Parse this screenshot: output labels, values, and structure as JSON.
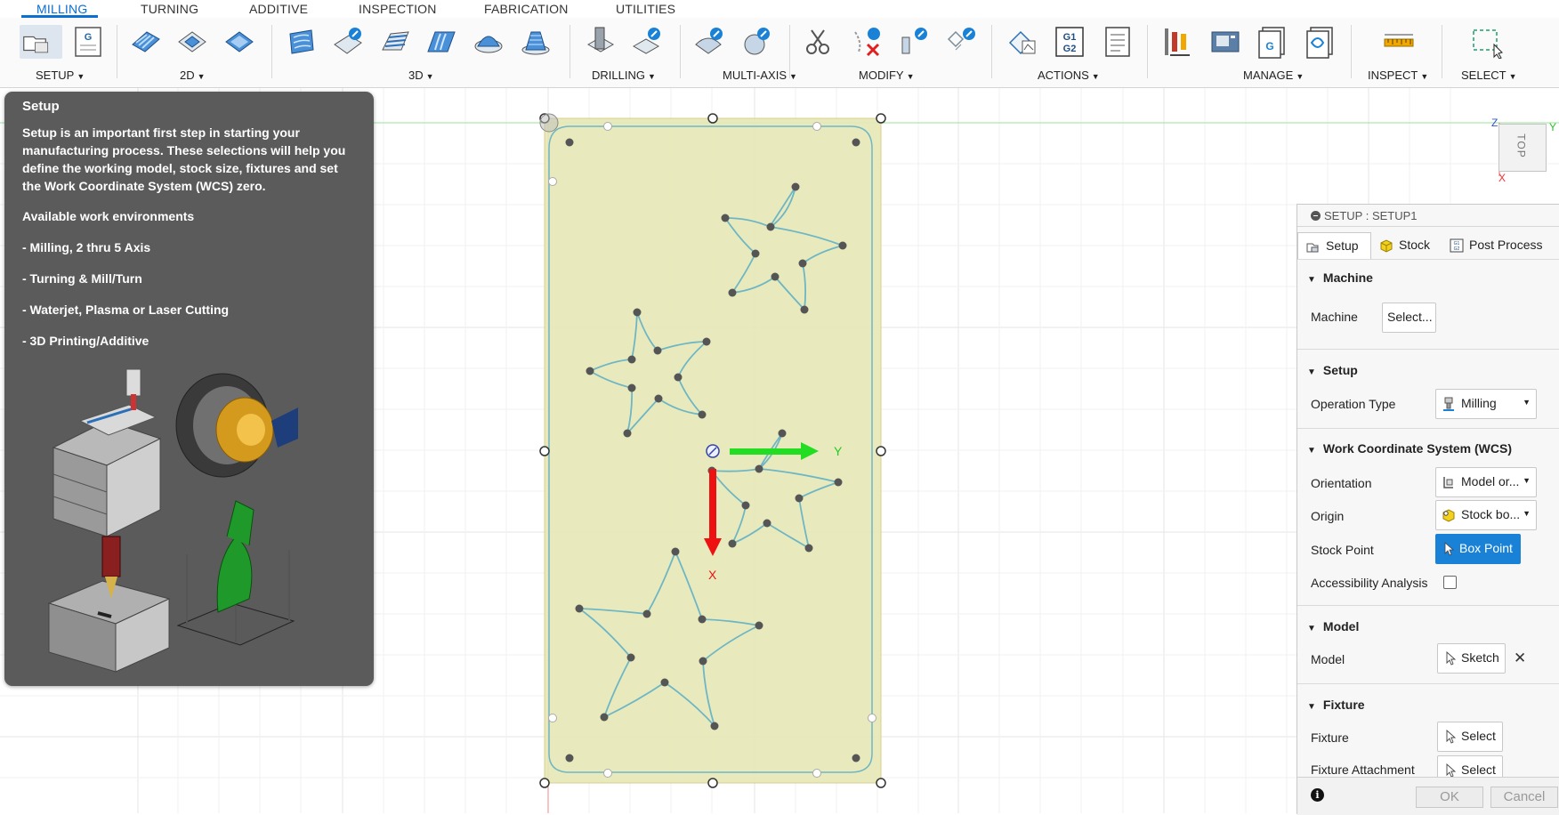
{
  "tabs": [
    "MILLING",
    "TURNING",
    "ADDITIVE",
    "INSPECTION",
    "FABRICATION",
    "UTILITIES"
  ],
  "active_tab": "MILLING",
  "groups": {
    "setup": "SETUP",
    "twod": "2D",
    "threed": "3D",
    "drilling": "DRILLING",
    "multiaxis": "MULTI-AXIS",
    "modify": "MODIFY",
    "actions": "ACTIONS",
    "manage": "MANAGE",
    "inspect": "INSPECT",
    "select": "SELECT"
  },
  "tooltip": {
    "title": "Setup",
    "description": "Setup is an important first step in starting your manufacturing process. These selections will help you define the working model, stock size, fixtures and set the Work Coordinate System (WCS) zero.",
    "environments_heading": "Available work environments",
    "items": [
      "- Milling, 2 thru 5 Axis",
      "- Turning & Mill/Turn",
      "- Waterjet, Plasma or Laser Cutting",
      "- 3D Printing/Additive"
    ]
  },
  "viewcube": {
    "face": "TOP",
    "axis_z": "Z",
    "axis_x": "X",
    "axis_y": "Y"
  },
  "triad": {
    "x_label": "X",
    "y_label": "Y"
  },
  "panel": {
    "title": "SETUP : SETUP1",
    "tabs": [
      "Setup",
      "Stock",
      "Post Process"
    ],
    "sections": {
      "machine": "Machine",
      "setup": "Setup",
      "wcs": "Work Coordinate System (WCS)",
      "model": "Model",
      "fixture": "Fixture"
    },
    "machine_label": "Machine",
    "machine_button": "Select...",
    "operation_type_label": "Operation Type",
    "operation_type_value": "Milling",
    "orientation_label": "Orientation",
    "orientation_value": "Model or...",
    "origin_label": "Origin",
    "origin_value": "Stock bo...",
    "stock_point_label": "Stock Point",
    "stock_point_value": "Box Point",
    "accessibility_label": "Accessibility Analysis",
    "model_label": "Model",
    "model_value": "Sketch",
    "fixture_label": "Fixture",
    "fixture_value": "Select",
    "fixture_attach_label": "Fixture Attachment",
    "fixture_attach_value": "Select",
    "ok": "OK",
    "cancel": "Cancel"
  },
  "colors": {
    "accent": "#0a6fd0",
    "stock_fill": "#e6e8b6",
    "profile": "#6fb6c4",
    "x_axis": "#ee1111",
    "y_axis": "#22dd22",
    "tooltip_bg": "#5b5b5b",
    "primary_button": "#1a82d6"
  }
}
